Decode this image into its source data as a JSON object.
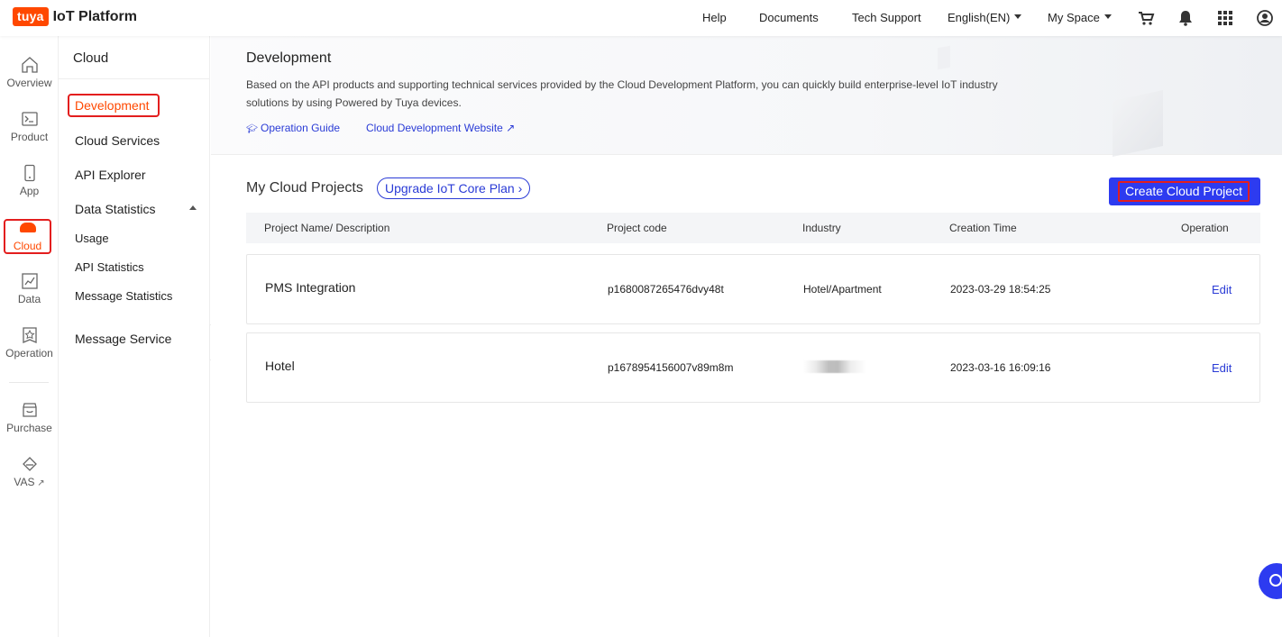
{
  "brand": {
    "logo_mark": "tuya",
    "logo_text": "IoT Platform"
  },
  "topnav": {
    "help": "Help",
    "documents": "Documents",
    "tech_support": "Tech Support",
    "language": "English(EN)",
    "my_space": "My Space",
    "icons": [
      "cart-icon",
      "bell-icon",
      "apps-grid-icon",
      "user-icon"
    ]
  },
  "rail": {
    "overview": "Overview",
    "product": "Product",
    "app": "App",
    "cloud": "Cloud",
    "data": "Data",
    "operation": "Operation",
    "purchase": "Purchase",
    "vas": "VAS"
  },
  "subnav": {
    "title": "Cloud",
    "development": "Development",
    "cloud_services": "Cloud Services",
    "api_explorer": "API Explorer",
    "data_statistics": "Data Statistics",
    "usage": "Usage",
    "api_statistics": "API Statistics",
    "message_statistics": "Message Statistics",
    "message_service": "Message Service"
  },
  "hero": {
    "title": "Development",
    "description": "Based on the API products and supporting technical services provided by the Cloud Development Platform, you can quickly build enterprise-level IoT industry solutions by using Powered by Tuya devices.",
    "operation_guide": "Operation Guide",
    "cloud_dev_website": "Cloud Development Website"
  },
  "projects": {
    "title": "My Cloud Projects",
    "upgrade_label": "Upgrade IoT Core Plan",
    "create_label": "Create Cloud Project",
    "columns": [
      "Project Name/ Description",
      "Project code",
      "Industry",
      "Creation Time",
      "Operation"
    ],
    "rows": [
      {
        "name": "PMS Integration",
        "code": "p1680087265476dvy48t",
        "industry": "Hotel/Apartment",
        "created": "2023-03-29 18:54:25",
        "action": "Edit"
      },
      {
        "name": "Hotel",
        "code": "p1678954156007v89m8m",
        "industry": "",
        "created": "2023-03-16 16:09:16",
        "action": "Edit"
      }
    ]
  },
  "colors": {
    "brand_orange": "#ff4800",
    "primary_blue": "#2d3bf0",
    "link_blue": "#2a3bd6",
    "highlight_red": "#e31e1e"
  }
}
